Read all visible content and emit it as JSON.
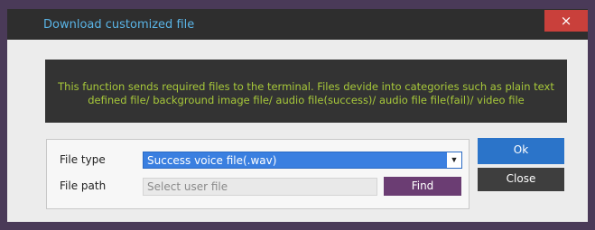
{
  "window": {
    "title": "Download customized file",
    "close_glyph": "×"
  },
  "info": {
    "text": "This function sends required files to the terminal. Files devide into categories such as plain text defined file/ background image file/ audio file(success)/ audio file file(fail)/ video file"
  },
  "form": {
    "file_type_label": "File type",
    "file_type_value": "Success voice file(.wav)",
    "file_path_label": "File path",
    "file_path_placeholder": "Select user file",
    "find_label": "Find"
  },
  "actions": {
    "ok_label": "Ok",
    "close_label": "Close"
  },
  "colors": {
    "title_text": "#5ab4e6",
    "info_text": "#a7c83a",
    "accent_blue": "#2b74c9",
    "find_purple": "#6b3d73",
    "close_red": "#c9403b"
  }
}
